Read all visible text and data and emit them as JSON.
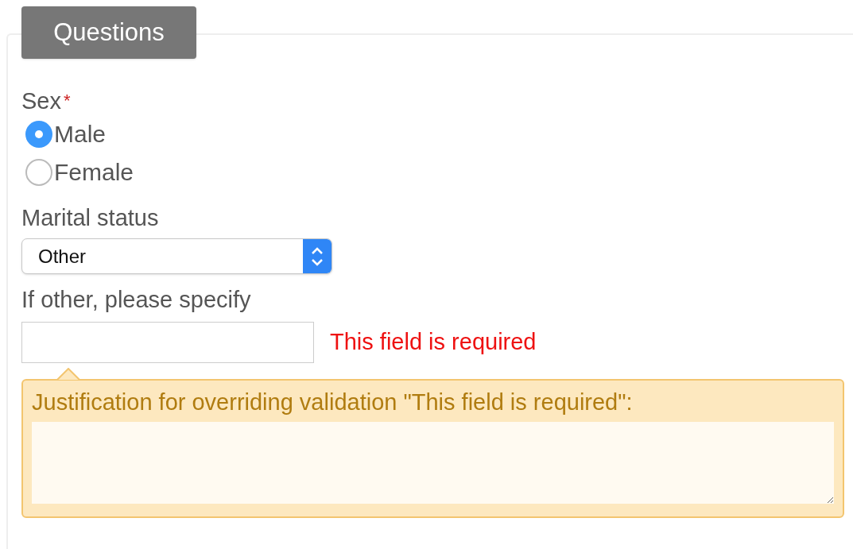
{
  "section": {
    "legend": "Questions"
  },
  "sex": {
    "label": "Sex",
    "required": true,
    "required_mark": "*",
    "options": [
      {
        "label": "Male",
        "selected": true
      },
      {
        "label": "Female",
        "selected": false
      }
    ]
  },
  "marital_status": {
    "label": "Marital status",
    "value": "Other"
  },
  "other": {
    "label": "If other, please specify",
    "error": "This field is required"
  },
  "justification": {
    "label": "Justification for overriding validation \"This field is required\":"
  }
}
